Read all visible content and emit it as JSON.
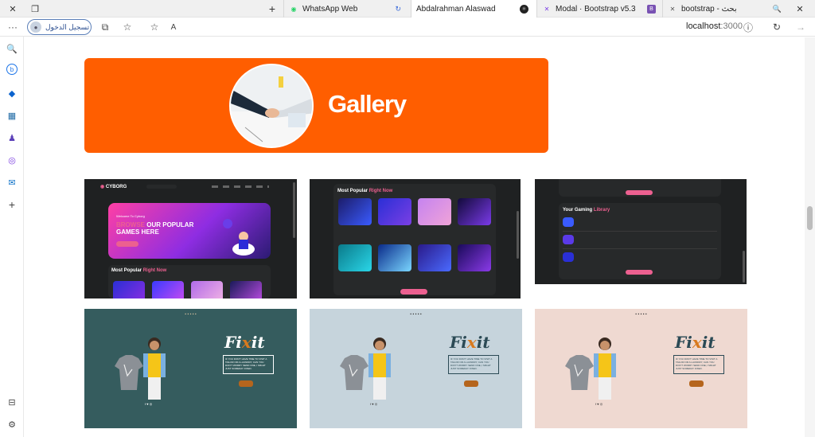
{
  "browser": {
    "tabs": [
      {
        "label": "WhatsApp Web",
        "active": false
      },
      {
        "label": "Abdalrahman Alaswad",
        "active": true
      },
      {
        "label": "Modal · Bootstrap v5.3",
        "active": false
      },
      {
        "label": "bootstrap - بحث",
        "active": false
      }
    ],
    "new_tab_label": "+",
    "sign_in_label": "تسجيل الدخول",
    "address": "localhost",
    "port": ":3000"
  },
  "gallery": {
    "title": "Gallery",
    "cyborg": {
      "logo": "CYBORG",
      "welcome": "Welcome To Cyborg",
      "headline_1": "BROWSE",
      "headline_2": "OUR POPULAR",
      "headline_3": "GAMES HERE",
      "section_1": "Most Popular",
      "section_1_accent": "Right Now",
      "section_2": "Your Gaming",
      "section_2_accent": "Library"
    },
    "fixit": {
      "logo_prefix": "Fi",
      "logo_accent": "x",
      "logo_suffix": "it",
      "quote": "IF YOU DON'T HAVE TIME TO VISIT A TAILOR OR A LAUNDRY, CAN YOU DON'T WORRY SEND ONE, I MIGHT JUST SOMEDAY FIXED."
    }
  },
  "colors": {
    "hero": "#ff5e00",
    "cyborg_pink": "#ec6090",
    "fixit_teal": "#355c5e",
    "fixit_blue": "#c6d4dc",
    "fixit_pink": "#efd9d1"
  }
}
